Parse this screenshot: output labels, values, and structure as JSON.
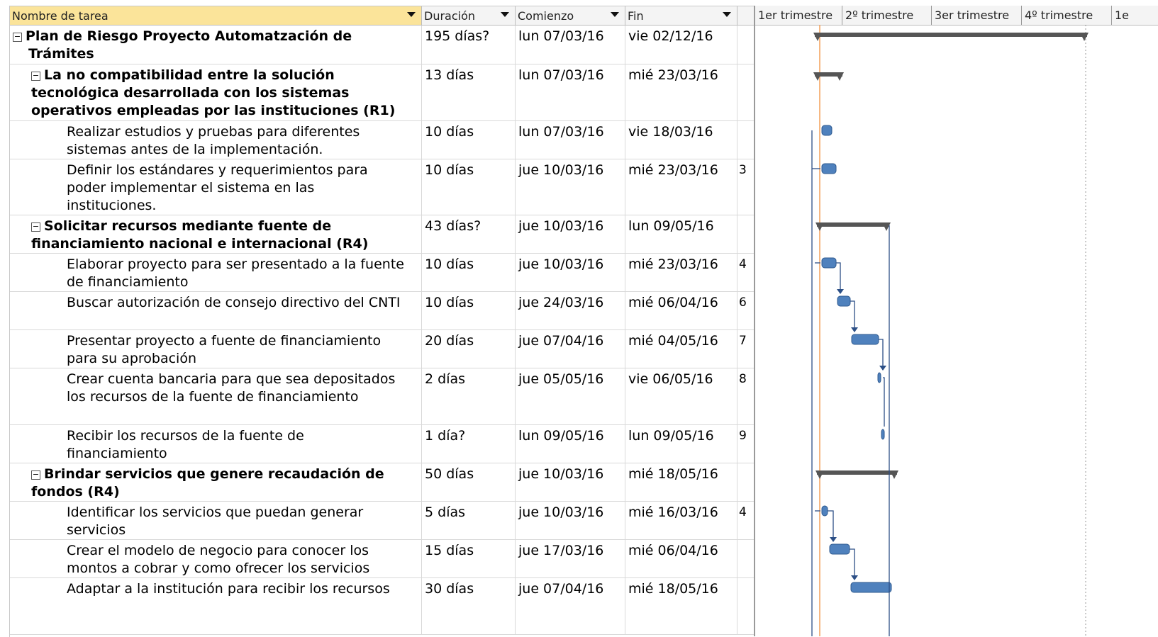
{
  "table": {
    "headers": {
      "name": "Nombre de tarea",
      "duration": "Duración",
      "start": "Comienzo",
      "end": "Fin"
    },
    "rows": [
      {
        "level": 0,
        "summary": true,
        "name": [
          "Plan de Riesgo Proyecto Automatzación de",
          "Trámites"
        ],
        "duration": "195 días?",
        "start": "lun 07/03/16",
        "end": "vie 02/12/16",
        "extra": ""
      },
      {
        "level": 1,
        "summary": true,
        "name": [
          "La no compatibilidad entre la solución",
          "tecnológica desarrollada con los sistemas",
          "operativos empleadas por las instituciones (R1)"
        ],
        "duration": "13 días",
        "start": "lun 07/03/16",
        "end": "mié 23/03/16",
        "extra": ""
      },
      {
        "level": 2,
        "summary": false,
        "name": [
          "Realizar estudios y pruebas para diferentes",
          "sistemas antes de la implementación."
        ],
        "duration": "10 días",
        "start": "lun 07/03/16",
        "end": "vie 18/03/16",
        "extra": ""
      },
      {
        "level": 2,
        "summary": false,
        "name": [
          "Definir los estándares y requerimientos para",
          "poder implementar el sistema en las",
          "instituciones."
        ],
        "duration": "10 días",
        "start": "jue 10/03/16",
        "end": "mié 23/03/16",
        "extra": "3"
      },
      {
        "level": 1,
        "summary": true,
        "name": [
          "Solicitar recursos mediante fuente de",
          "financiamiento nacional e internacional (R4)"
        ],
        "duration": "43 días?",
        "start": "jue 10/03/16",
        "end": "lun 09/05/16",
        "extra": ""
      },
      {
        "level": 2,
        "summary": false,
        "name": [
          "Elaborar proyecto para ser presentado a la fuente",
          "de financiamiento"
        ],
        "duration": "10 días",
        "start": "jue 10/03/16",
        "end": "mié 23/03/16",
        "extra": "4"
      },
      {
        "level": 2,
        "summary": false,
        "name": [
          "Buscar autorización de consejo directivo del CNTI"
        ],
        "duration": "10 días",
        "start": "jue 24/03/16",
        "end": "mié 06/04/16",
        "extra": "6"
      },
      {
        "level": 2,
        "summary": false,
        "name": [
          "Presentar proyecto a fuente de financiamiento",
          "para su aprobación"
        ],
        "duration": "20 días",
        "start": "jue 07/04/16",
        "end": "mié 04/05/16",
        "extra": "7"
      },
      {
        "level": 2,
        "summary": false,
        "name": [
          "Crear cuenta bancaria para que sea depositados",
          "los recursos de la fuente de financiamiento"
        ],
        "duration": "2 días",
        "start": "jue 05/05/16",
        "end": "vie 06/05/16",
        "extra": "8"
      },
      {
        "level": 2,
        "summary": false,
        "name": [
          "Recibir los recursos de la fuente de",
          "financiamiento"
        ],
        "duration": "1 día?",
        "start": "lun 09/05/16",
        "end": "lun 09/05/16",
        "extra": "9"
      },
      {
        "level": 1,
        "summary": true,
        "name": [
          "Brindar servicios que genere recaudación de",
          "fondos (R4)"
        ],
        "duration": "50 días",
        "start": "jue 10/03/16",
        "end": "mié 18/05/16",
        "extra": ""
      },
      {
        "level": 2,
        "summary": false,
        "name": [
          "Identificar los servicios que puedan generar",
          "servicios"
        ],
        "duration": "5 días",
        "start": "jue 10/03/16",
        "end": "mié 16/03/16",
        "extra": "4"
      },
      {
        "level": 2,
        "summary": false,
        "name": [
          "Crear el modelo de negocio para conocer los",
          "montos a cobrar y como ofrecer los servicios"
        ],
        "duration": "15 días",
        "start": "jue 17/03/16",
        "end": "mié 06/04/16",
        "extra": ""
      },
      {
        "level": 2,
        "summary": false,
        "name": [
          "Adaptar a la institución para recibir los recursos"
        ],
        "duration": "30 días",
        "start": "jue 07/04/16",
        "end": "mié 18/05/16",
        "extra": ""
      }
    ]
  },
  "gantt": {
    "quarters": [
      "1er trimestre",
      "2º trimestre",
      "3er trimestre",
      "4º trimestre",
      "1e"
    ],
    "colors": {
      "bar": "#4f81bd",
      "bar_dark": "#2f5a8f",
      "summary": "#555555",
      "today_line": "#f4a05a",
      "link": "#2c4f86"
    }
  }
}
